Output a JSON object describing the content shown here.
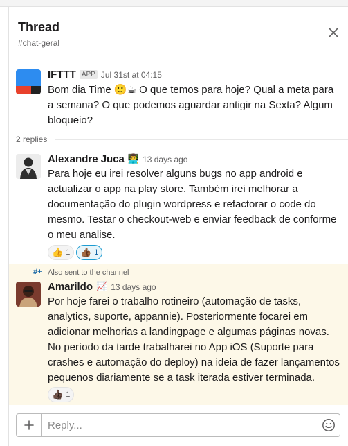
{
  "header": {
    "title": "Thread",
    "channel": "#chat-geral"
  },
  "messages": [
    {
      "sender": "IFTTT",
      "badge": "APP",
      "time": "Jul 31st at 04:15",
      "text_before_emoji": "Bom dia Time ",
      "emoji_1": "🙂",
      "emoji_2": "☕",
      "text_after_emoji": " O que temos para hoje? Qual a meta para a semana? O que podemos aguardar antigir na Sexta? Algum bloqueio?"
    },
    {
      "sender": "Alexandre Juca",
      "status_emoji": "👨‍💻",
      "time": "13 days ago",
      "text": "Para hoje eu irei resolver alguns bugs no app android e actualizar o app na play store. Também irei melhorar a documentação do plugin wordpress e refactorar o code do mesmo. Testar o checkout-web e enviar feedback de conforme o meu analise.",
      "reactions": [
        {
          "emoji": "👍",
          "count": "1",
          "active": false
        },
        {
          "emoji": "👍🏾",
          "count": "1",
          "active": true
        }
      ]
    },
    {
      "also_sent": "Also sent to the channel",
      "sender": "Amarildo",
      "status_emoji": "📈",
      "time": "13 days ago",
      "text": "Por hoje farei o trabalho rotineiro (automação de tasks, analytics, suporte, appannie). Posteriormente focarei em adicionar melhorias a landingpage e algumas páginas novas. No período da tarde trabalharei no App iOS (Suporte para crashes e automação do deploy) na ideia de fazer lançamentos pequenos diariamente se a task iterada estiver terminada.",
      "reactions": [
        {
          "emoji": "👍🏿",
          "count": "1",
          "active": false
        }
      ]
    }
  ],
  "replies_label": "2 replies",
  "composer": {
    "placeholder": "Reply..."
  },
  "colors": {
    "ifttt_blue": "#2d8cf0",
    "ifttt_red": "#e8412c",
    "ifttt_dark": "#222222",
    "highlight_bg": "#fdf8e8",
    "accent": "#1264a3"
  },
  "icons": {
    "close": "close-icon",
    "plus": "plus-icon",
    "emoji": "smiley-icon",
    "share": "share-channel-icon"
  }
}
